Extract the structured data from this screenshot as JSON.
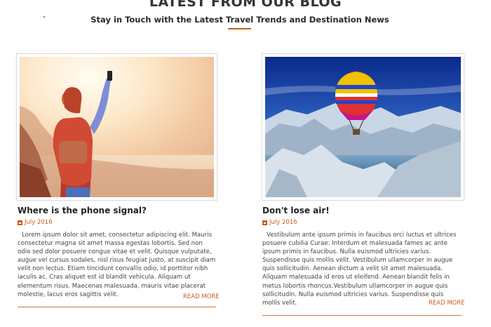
{
  "header": {
    "title": "LATEST FROM OUR BLOG",
    "subtitle": "Stay in Touch with the Latest Travel Trends and Destination News"
  },
  "posts": [
    {
      "title": "Where is the  phone signal?",
      "date": "July 2016",
      "body": "Lorem ipsum dolor sit amet, consectetur adipiscing elit. Mauris consectetur magna sit amet massa egestas lobortis. Sed non odio sed dolor posuere congue vitae et velit. Quisque vulputate, augue vel cursus sodales, nisl risus feugiat justo, at suscipit diam velit non lectus. Etiam tincidunt convallis odio, id porttitor nibh iaculis ac. Cras aliquet est id blandit vehicula. Aliquam ut elementum risus. Maecenas malesuada, mauris vitae placerat molestie, lacus eros sagittis velit.",
      "read_more": "READ MORE",
      "image_icon": "hiker-phone-image"
    },
    {
      "title": "Don't lose air!",
      "date": "July 2016",
      "body": "Vestibulum ante ipsum primis in faucibus orci luctus et ultrices posuere cubilia Curae: Interdum et malesuada fames ac ante ipsum primis in faucibus. Nulla euismod ultricies varius. Suspendisse quis mollis velit. Vestibulum ullamcorper in augue quis sollicitudin. Aenean dictum a velit sit amet malesuada. Aliquam malesuada id eros ut eleifend. Aenean blandit felis in metus lobortis rhoncus.Vestibulum ullamcorper in augue quis sollicitudin. Nulla euismod ultricies varius. Suspendisse quis mollis velit.",
      "read_more": "READ MORE",
      "image_icon": "hot-air-balloon-image"
    }
  ],
  "colors": {
    "accent": "#c95d1c",
    "text": "#333333"
  }
}
